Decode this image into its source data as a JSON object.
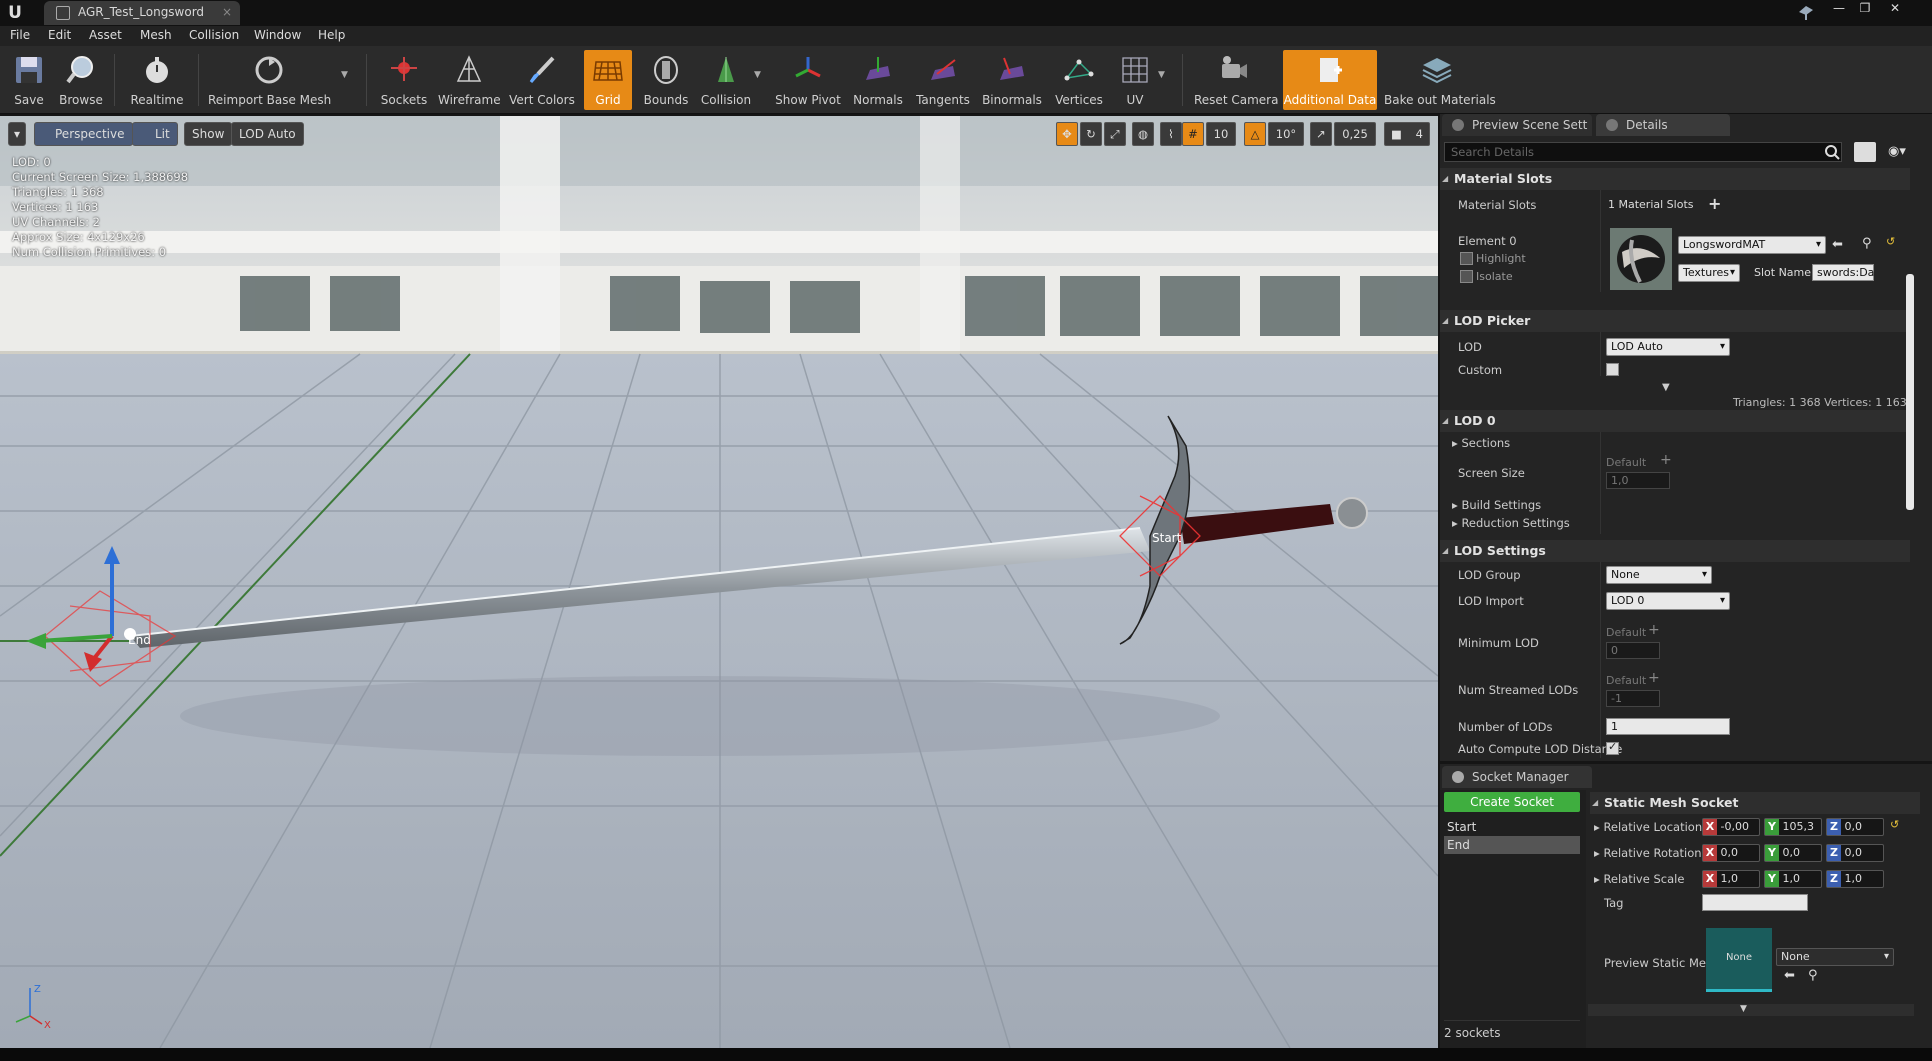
{
  "window": {
    "tab_title": "AGR_Test_Longsword",
    "tab_close": "×",
    "controls": [
      "—",
      "❐",
      "✕"
    ]
  },
  "menu": [
    "File",
    "Edit",
    "Asset",
    "Mesh",
    "Collision",
    "Window",
    "Help"
  ],
  "toolbar": {
    "save": "Save",
    "browse": "Browse",
    "realtime": "Realtime",
    "reimport": "Reimport Base Mesh",
    "sockets": "Sockets",
    "wireframe": "Wireframe",
    "vert_colors": "Vert Colors",
    "grid": "Grid",
    "bounds": "Bounds",
    "collision": "Collision",
    "show_pivot": "Show Pivot",
    "normals": "Normals",
    "tangents": "Tangents",
    "binormals": "Binormals",
    "vertices": "Vertices",
    "uv": "UV",
    "reset_camera": "Reset Camera",
    "additional_data": "Additional Data",
    "bake_out": "Bake out Materials",
    "active": "Grid",
    "accent": "#e78a16"
  },
  "viewport": {
    "dropdown": "▾",
    "perspective": "Perspective",
    "lit": "Lit",
    "show": "Show",
    "lod": "LOD Auto",
    "stats": [
      "LOD:  0",
      "Current Screen Size:  1,388698",
      "Triangles:  1 368",
      "Vertices:  1 163",
      "UV Channels:  2",
      "Approx Size: 4x129x26",
      "Num Collision Primitives:  0"
    ],
    "grid_size": "10",
    "rot_snap": "10°",
    "scale_snap": "0,25",
    "cam_speed": "4",
    "socket_start": "Start",
    "socket_end": "End",
    "axis_z": "Z",
    "axis_x": "X"
  },
  "details": {
    "tab_scene": "Preview Scene Sett",
    "tab_details": "Details",
    "search_placeholder": "Search Details",
    "material_slots_header": "Material Slots",
    "material_slots_label": "Material Slots",
    "material_slots_value": "1 Material Slots",
    "element0": "Element 0",
    "highlight": "Highlight",
    "isolate": "Isolate",
    "material_name": "LongswordMAT",
    "textures_btn": "Textures",
    "slot_name_label": "Slot Name",
    "slot_name_value": "swords:Da",
    "lod_picker_header": "LOD Picker",
    "lod_label": "LOD",
    "lod_value": "LOD Auto",
    "custom_label": "Custom",
    "tri_info": "Triangles: 1 368   Vertices: 1 163",
    "lod0_header": "LOD 0",
    "sections": "Sections",
    "screen_size": "Screen Size",
    "default": "Default",
    "screen_size_val": "1,0",
    "build_settings": "Build Settings",
    "reduction_settings": "Reduction Settings",
    "lod_settings_header": "LOD Settings",
    "lod_group": "LOD Group",
    "lod_group_val": "None",
    "lod_import": "LOD Import",
    "lod_import_val": "LOD 0",
    "min_lod": "Minimum LOD",
    "min_lod_val": "0",
    "num_streamed": "Num Streamed LODs",
    "num_streamed_val": "-1",
    "number_of_lods": "Number of LODs",
    "number_of_lods_val": "1",
    "auto_compute": "Auto Compute LOD Distance"
  },
  "sockets": {
    "tab": "Socket Manager",
    "create": "Create Socket",
    "list": [
      "Start",
      "End"
    ],
    "selected": "End",
    "count": "2 sockets",
    "header": "Static Mesh Socket",
    "rel_loc": "Relative Location",
    "rel_rot": "Relative Rotation",
    "rel_scale": "Relative Scale",
    "loc": {
      "x": "-0,00",
      "y": "105,3",
      "z": "0,0"
    },
    "rot": {
      "x": "0,0",
      "y": "0,0",
      "z": "0,0"
    },
    "scale": {
      "x": "1,0",
      "y": "1,0",
      "z": "1,0"
    },
    "tag": "Tag",
    "preview_mesh": "Preview Static Me",
    "thumb_none": "None",
    "mesh_combo": "None",
    "create_color": "#3fae3f"
  }
}
